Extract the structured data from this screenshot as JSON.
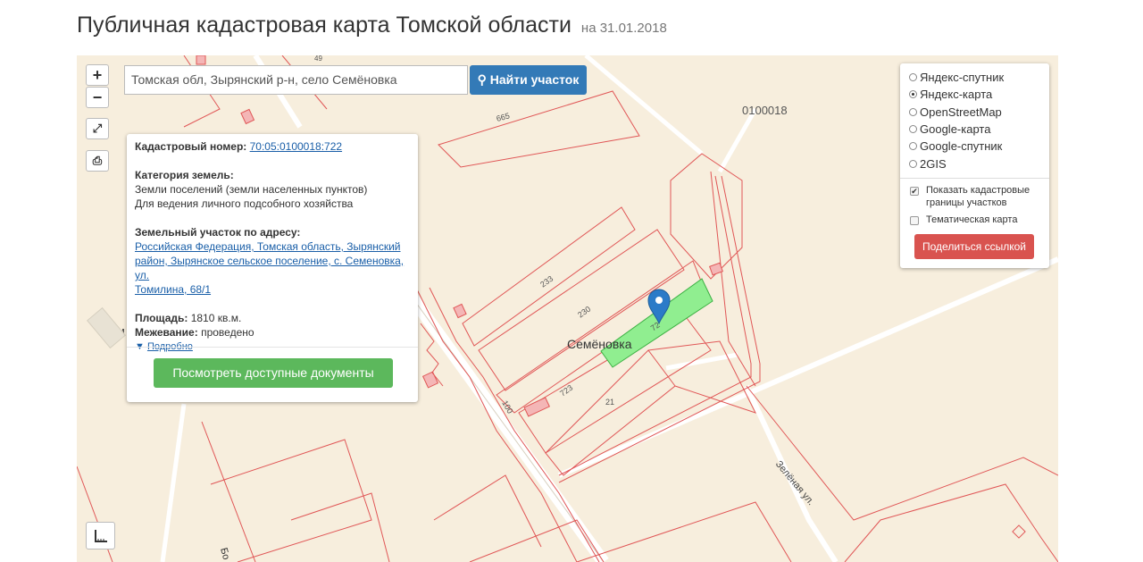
{
  "page": {
    "title": "Публичная кадастровая карта Томской области",
    "date": "на 31.01.2018"
  },
  "map": {
    "controls": {
      "zoom_in": "+",
      "zoom_out": "−"
    },
    "search": {
      "value": "Томская обл, Зырянский р-н, село Семёновка",
      "button_label": "Найти участок"
    },
    "block_label": "0100018",
    "settlement_label": "Семёновка",
    "street_label": "Зелёная ул.",
    "parcel_labels": {
      "p665": "665",
      "p233": "233",
      "p230": "230",
      "p723": "723",
      "p21": "21",
      "p100": "100",
      "p49": "49",
      "p722": "72"
    },
    "cut_labels": {
      "left": "Сем",
      "road": "Бо"
    }
  },
  "popup": {
    "cadastral_label": "Кадастровый номер:",
    "cadastral_number": "70:05:0100018:722",
    "category_label": "Категория земель:",
    "category_value": "Земли поселений (земли населенных пунктов)",
    "use_value": "Для ведения личного подсобного хозяйства",
    "address_label": "Земельный участок по адресу:",
    "address_line1": "Российская Федерация, Томская область, Зырянский",
    "address_line2": "район, Зырянское сельское поселение, с. Семеновка, ул.",
    "address_line3": "Томилина, 68/1",
    "area_label": "Площадь:",
    "area_value": "1810 кв.м.",
    "survey_label": "Межевание:",
    "survey_value": "проведено",
    "more_link": "Подробно",
    "docs_button": "Посмотреть доступные документы"
  },
  "layers": {
    "options": [
      {
        "label": "Яндекс-спутник",
        "selected": false
      },
      {
        "label": "Яндекс-карта",
        "selected": true
      },
      {
        "label": "OpenStreetMap",
        "selected": false
      },
      {
        "label": "Google-карта",
        "selected": false
      },
      {
        "label": "Google-спутник",
        "selected": false
      },
      {
        "label": "2GIS",
        "selected": false
      }
    ],
    "show_borders_label": "Показать кадастровые границы участков",
    "show_borders_checked": true,
    "thematic_label": "Тематическая карта",
    "thematic_checked": false,
    "share_button": "Поделиться ссылкой"
  },
  "colors": {
    "map_bg": "#f7eedd",
    "boundary": "#e05656",
    "selected_parcel": "#90ee90",
    "marker": "#2b7bc8",
    "search_btn": "#337ab7",
    "docs_btn": "#5cb85c",
    "share_btn": "#d9534f"
  }
}
